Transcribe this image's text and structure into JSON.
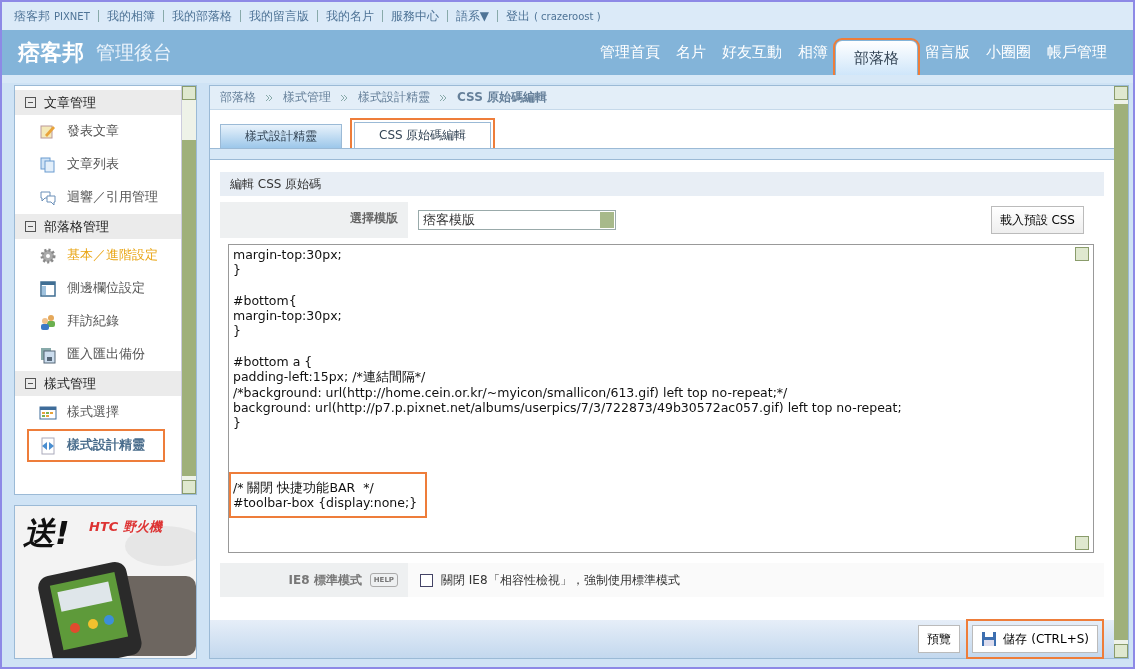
{
  "top_links": [
    {
      "label": "痞客邦",
      "sub": "PIXNET"
    },
    {
      "label": "我的相簿"
    },
    {
      "label": "我的部落格"
    },
    {
      "label": "我的留言版"
    },
    {
      "label": "我的名片"
    },
    {
      "label": "服務中心"
    },
    {
      "label": "語系▼"
    },
    {
      "label": "登出",
      "sub": "( crazeroost )"
    }
  ],
  "logo": {
    "brand": "痞客邦",
    "title": "管理後台"
  },
  "nav": [
    {
      "label": "管理首頁",
      "selected": false,
      "highlighted": false
    },
    {
      "label": "名片",
      "selected": false,
      "highlighted": false
    },
    {
      "label": "好友互動",
      "selected": false,
      "highlighted": false
    },
    {
      "label": "相簿",
      "selected": false,
      "highlighted": false
    },
    {
      "label": "部落格",
      "selected": true,
      "highlighted": true
    },
    {
      "label": "留言版",
      "selected": false,
      "highlighted": false
    },
    {
      "label": "小圈圈",
      "selected": false,
      "highlighted": false
    },
    {
      "label": "帳戶管理",
      "selected": false,
      "highlighted": false
    }
  ],
  "sidebar": {
    "sections": [
      {
        "title": "文章管理",
        "expanded": true,
        "items": [
          {
            "label": "發表文章",
            "current": false,
            "selected": false,
            "highlighted": false
          },
          {
            "label": "文章列表",
            "current": false,
            "selected": false,
            "highlighted": false
          },
          {
            "label": "迴響／引用管理",
            "current": false,
            "selected": false,
            "highlighted": false
          }
        ]
      },
      {
        "title": "部落格管理",
        "expanded": true,
        "items": [
          {
            "label": "基本／進階設定",
            "current": true,
            "selected": false,
            "highlighted": false
          },
          {
            "label": "側邊欄位設定",
            "current": false,
            "selected": false,
            "highlighted": false
          },
          {
            "label": "拜訪紀錄",
            "current": false,
            "selected": false,
            "highlighted": false
          },
          {
            "label": "匯入匯出備份",
            "current": false,
            "selected": false,
            "highlighted": false
          }
        ]
      },
      {
        "title": "樣式管理",
        "expanded": true,
        "items": [
          {
            "label": "樣式選擇",
            "current": false,
            "selected": false,
            "highlighted": false
          },
          {
            "label": "樣式設計精靈",
            "current": false,
            "selected": true,
            "highlighted": true
          }
        ]
      }
    ]
  },
  "ad": {
    "headline": "送!",
    "product": "HTC 野火機",
    "kind": "picture"
  },
  "breadcrumb": [
    "部落格",
    "樣式管理",
    "樣式設計精靈",
    "CSS 原始碼編輯"
  ],
  "tabs": [
    {
      "label": "樣式設計精靈",
      "selected": false,
      "highlighted": false
    },
    {
      "label": "CSS 原始碼編輯",
      "selected": true,
      "highlighted": true
    }
  ],
  "section_title": "編輯 CSS 原始碼",
  "template": {
    "label": "選擇模版",
    "value": "痞客模版",
    "load_button": "載入預設 CSS"
  },
  "code": [
    {
      "highlighted": false,
      "lines": [
        "margin-top:30px;",
        "}"
      ]
    },
    {
      "highlighted": false,
      "lines": [
        "#bottom{",
        "margin-top:30px;",
        "}"
      ]
    },
    {
      "highlighted": false,
      "lines": [
        "#bottom a {",
        "padding-left:15px; /*連結間隔*/",
        "/*background: url(http://home.cein.or.kr/~myicon/smallicon/613.gif) left top no-repeat;*/",
        "background: url(http://p7.p.pixnet.net/albums/userpics/7/3/722873/49b30572ac057.gif) left top no-repeat;",
        "}"
      ]
    },
    {
      "highlighted": true,
      "lines": [
        "/* 關閉 快捷功能BAR  */",
        "#toolbar-box {display:none;}"
      ]
    }
  ],
  "ie8": {
    "label": "IE8 標準模式",
    "help": "HELP",
    "option": "關閉 IE8「相容性檢視」，強制使用標準模式",
    "checked": false
  },
  "buttons": [
    {
      "label": "預覽",
      "highlighted": false
    },
    {
      "label": "儲存 (CTRL+S)",
      "highlighted": true
    }
  ]
}
